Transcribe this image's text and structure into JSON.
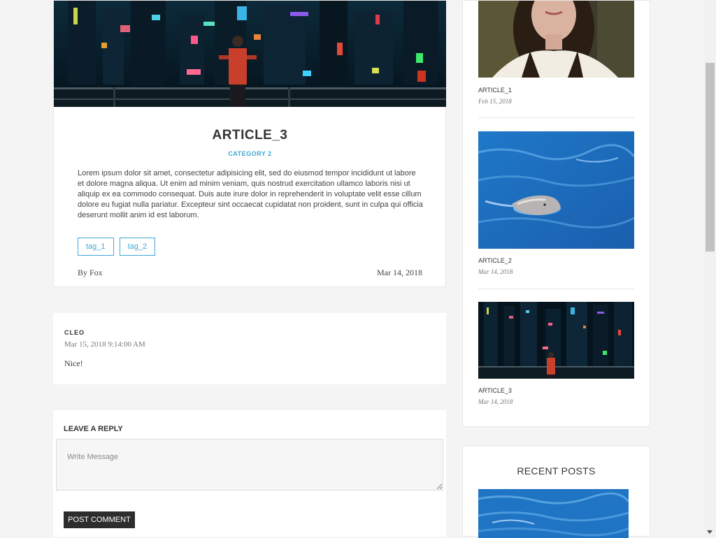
{
  "article": {
    "title": "ARTICLE_3",
    "category": "CATEGORY 2",
    "body": "Lorem ipsum dolor sit amet, consectetur adipisicing elit, sed do eiusmod tempor incididunt ut labore et dolore magna aliqua. Ut enim ad minim veniam, quis nostrud exercitation ullamco laboris nisi ut aliquip ex ea commodo consequat. Duis aute irure dolor in reprehenderit in voluptate velit esse cillum dolore eu fugiat nulla pariatur. Excepteur sint occaecat cupidatat non proident, sunt in culpa qui officia deserunt mollit anim id est laborum.",
    "tags": [
      "tag_1",
      "tag_2"
    ],
    "author": "By Fox",
    "date": "Mar 14, 2018"
  },
  "comment": {
    "author": "CLEO",
    "timestamp": "Mar 15, 2018 9:14:00 AM",
    "text": "Nice!"
  },
  "reply": {
    "title": "LEAVE A REPLY",
    "placeholder": "Write Message",
    "button_label": "POST COMMENT"
  },
  "sidebar": {
    "items": [
      {
        "title": "ARTICLE_1",
        "date": "Feb 15, 2018",
        "thumb": "portrait-photo"
      },
      {
        "title": "ARTICLE_2",
        "date": "Mar 14, 2018",
        "thumb": "dolphin-photo"
      },
      {
        "title": "ARTICLE_3",
        "date": "Mar 14, 2018",
        "thumb": "city-night-photo"
      }
    ]
  },
  "recent_posts": {
    "title": "RECENT POSTS",
    "thumb": "dolphin-photo"
  },
  "colors": {
    "accent": "#3fa6d6",
    "page_background": "#f4f4f4",
    "button_dark": "#2d2d2d"
  }
}
